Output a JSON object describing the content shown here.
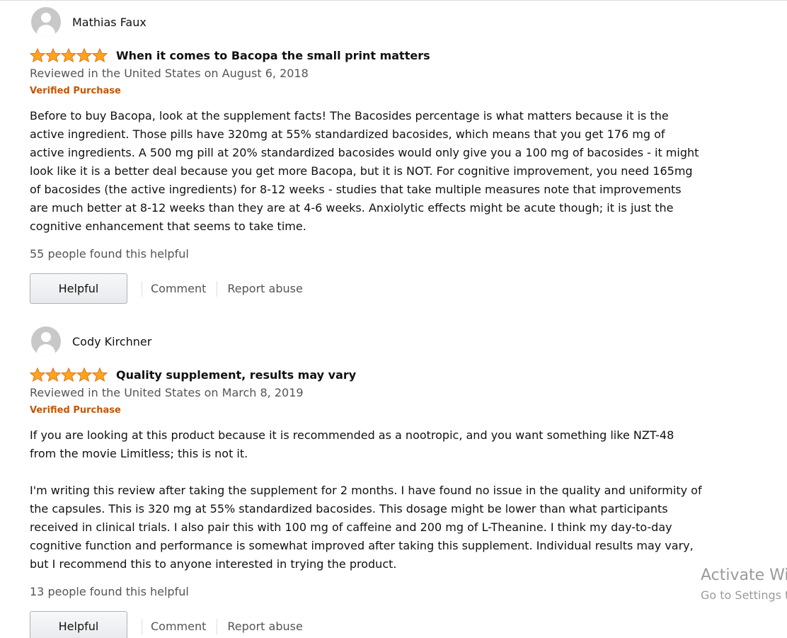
{
  "reviews": [
    {
      "author": "Mathias Faux",
      "rating": 5,
      "title": "When it comes to Bacopa the small print matters",
      "date": "Reviewed in the United States on August 6, 2018",
      "verified": "Verified Purchase",
      "body": [
        "Before to buy Bacopa, look at the supplement facts! The Bacosides percentage is what matters because it is the active ingredient. Those pills have 320mg at 55% standardized bacosides, which means that you get 176 mg of active ingredients. A 500 mg pill at 20% standardized bacosides would only give you a 100 mg of bacosides - it might look like it is a better deal because you get more Bacopa, but it is NOT. For cognitive improvement, you need 165mg of bacosides (the active ingredients) for 8-12 weeks - studies that take multiple measures note that improvements are much better at 8-12 weeks than they are at 4-6 weeks. Anxiolytic effects might be acute though; it is just the cognitive enhancement that seems to take time."
      ],
      "helpful_text": "55 people found this helpful",
      "helpful_button": "Helpful",
      "comment_label": "Comment",
      "report_label": "Report abuse"
    },
    {
      "author": "Cody Kirchner",
      "rating": 5,
      "title": "Quality supplement, results may vary",
      "date": "Reviewed in the United States on March 8, 2019",
      "verified": "Verified Purchase",
      "body": [
        "If you are looking at this product because it is recommended as a nootropic, and you want something like NZT-48 from the movie Limitless; this is not it.",
        "I'm writing this review after taking the supplement for 2 months. I have found no issue in the quality and uniformity of the capsules. This is 320 mg at 55% standardized bacosides. This dosage might be lower than what participants received in clinical trials. I also pair this with 100 mg of caffeine and 200 mg of L-Theanine. I think my day-to-day cognitive function and performance is somewhat improved after taking this supplement. Individual results may vary, but I recommend this to anyone interested in trying the product."
      ],
      "helpful_text": "13 people found this helpful",
      "helpful_button": "Helpful",
      "comment_label": "Comment",
      "report_label": "Report abuse"
    }
  ],
  "watermark": {
    "title": "Activate Wi",
    "subtitle": "Go to Settings t"
  },
  "colors": {
    "star": "#ffa41c",
    "star_outline": "#de7921",
    "verified": "#c45500",
    "secondary_text": "#555555"
  },
  "icons": {
    "avatar": "default-avatar-icon",
    "star": "star-icon"
  }
}
